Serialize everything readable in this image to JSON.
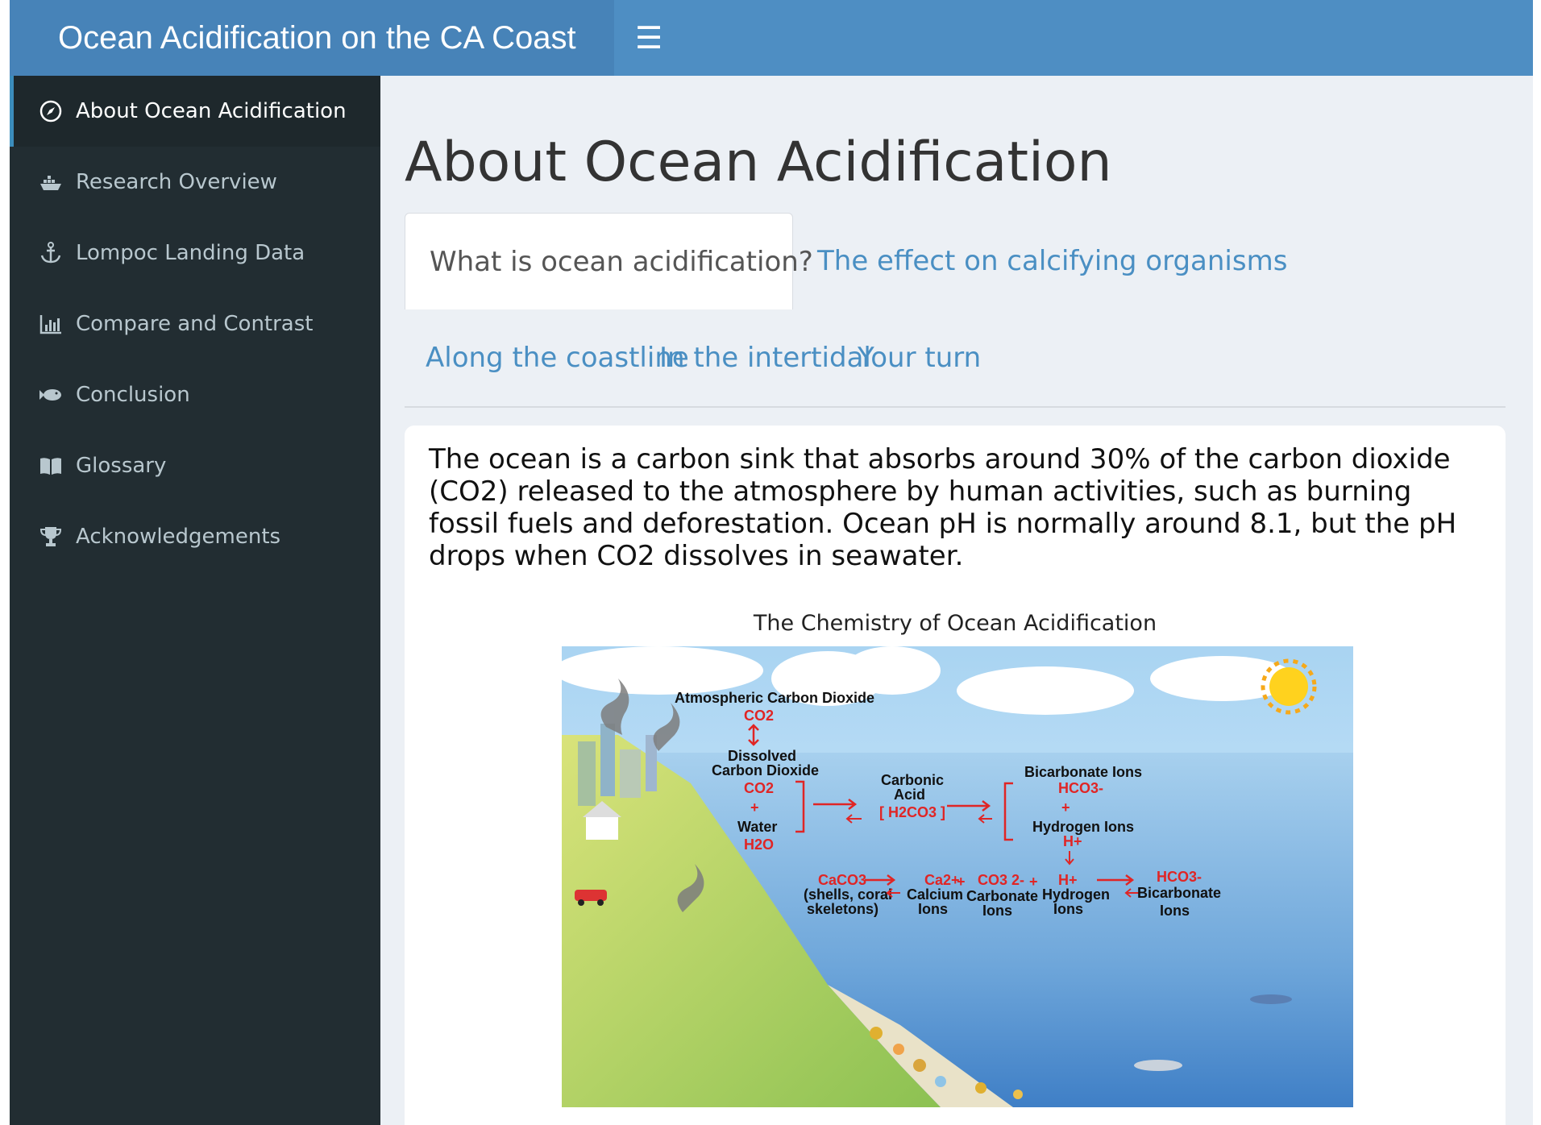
{
  "app": {
    "title": "Ocean Acidification on the CA Coast",
    "menu_icon": "hamburger-icon"
  },
  "sidebar": {
    "items": [
      {
        "label": "About Ocean Acidification",
        "icon": "compass-icon",
        "active": true
      },
      {
        "label": "Research Overview",
        "icon": "ship-icon",
        "active": false
      },
      {
        "label": "Lompoc Landing Data",
        "icon": "anchor-icon",
        "active": false
      },
      {
        "label": "Compare and Contrast",
        "icon": "bar-chart-icon",
        "active": false
      },
      {
        "label": "Conclusion",
        "icon": "fish-icon",
        "active": false
      },
      {
        "label": "Glossary",
        "icon": "book-icon",
        "active": false
      },
      {
        "label": "Acknowledgements",
        "icon": "trophy-icon",
        "active": false
      }
    ]
  },
  "main": {
    "title": "About Ocean Acidification",
    "tabs": [
      {
        "label": "What is ocean acidification?",
        "active": true
      },
      {
        "label": "The effect on calcifying organisms",
        "active": false
      },
      {
        "label": "Along the coastline",
        "active": false
      },
      {
        "label": "In the intertidal",
        "active": false
      },
      {
        "label": "Your turn",
        "active": false
      }
    ],
    "paragraph": "The ocean is a carbon sink that absorbs around 30% of the carbon dioxide (CO2) released to the atmosphere by human activities, such as burning fossil fuels and deforestation. Ocean pH is normally around 8.1, but the pH drops when CO2 dissolves in seawater.",
    "figure": {
      "title": "The Chemistry of Ocean Acidification",
      "labels": {
        "atmospheric": "Atmospheric Carbon Dioxide",
        "co2": "CO2",
        "dissolved_1": "Dissolved",
        "dissolved_2": "Carbon Dioxide",
        "plus": "+",
        "water": "Water",
        "h2o": "H2O",
        "carbonic_1": "Carbonic",
        "carbonic_2": "Acid",
        "h2co3": "[ H2CO3 ]",
        "bicarb_title": "Bicarbonate Ions",
        "hco3": "HCO3-",
        "hydrogen_title": "Hydrogen Ions",
        "h_plus": "H+",
        "caco3": "CaCO3",
        "shells_1": "(shells, coral",
        "shells_2": "skeletons)",
        "ca2": "Ca2+",
        "calcium_1": "Calcium",
        "calcium_2": "Ions",
        "co3": "CO3 2-",
        "carbonate_1": "Carbonate",
        "carbonate_2": "Ions",
        "hydrogen_1": "Hydrogen",
        "hydrogen_2": "Ions",
        "bicarbonate_1": "Bicarbonate",
        "bicarbonate_2": "Ions"
      }
    }
  },
  "colors": {
    "header": "#4e8ec3",
    "brand": "#4783b8",
    "sidebar": "#222d32",
    "link": "#4a8fc3",
    "reaction_red": "#e02525"
  }
}
